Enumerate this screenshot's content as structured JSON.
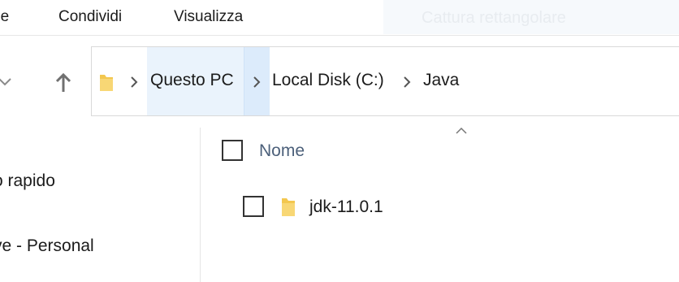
{
  "ribbon": {
    "tabs": [
      {
        "label": "he"
      },
      {
        "label": "Condividi"
      },
      {
        "label": "Visualizza"
      }
    ],
    "overlay_text": "Cattura rettangolare"
  },
  "address_bar": {
    "breadcrumbs": [
      {
        "label": "Questo PC"
      },
      {
        "label": "Local Disk (C:)"
      },
      {
        "label": "Java"
      }
    ]
  },
  "navigation_pane": {
    "items": [
      {
        "label": "o rapido"
      },
      {
        "label": "ve - Personal"
      }
    ]
  },
  "file_list": {
    "columns": [
      {
        "label": "Nome"
      }
    ],
    "sort": "ascending",
    "rows": [
      {
        "name": "jdk-11.0.1",
        "type": "folder"
      }
    ]
  },
  "colors": {
    "breadcrumb_highlight": "#eaf3fc",
    "column_header_text": "#4c607a",
    "folder_yellow": "#f3c74f"
  }
}
